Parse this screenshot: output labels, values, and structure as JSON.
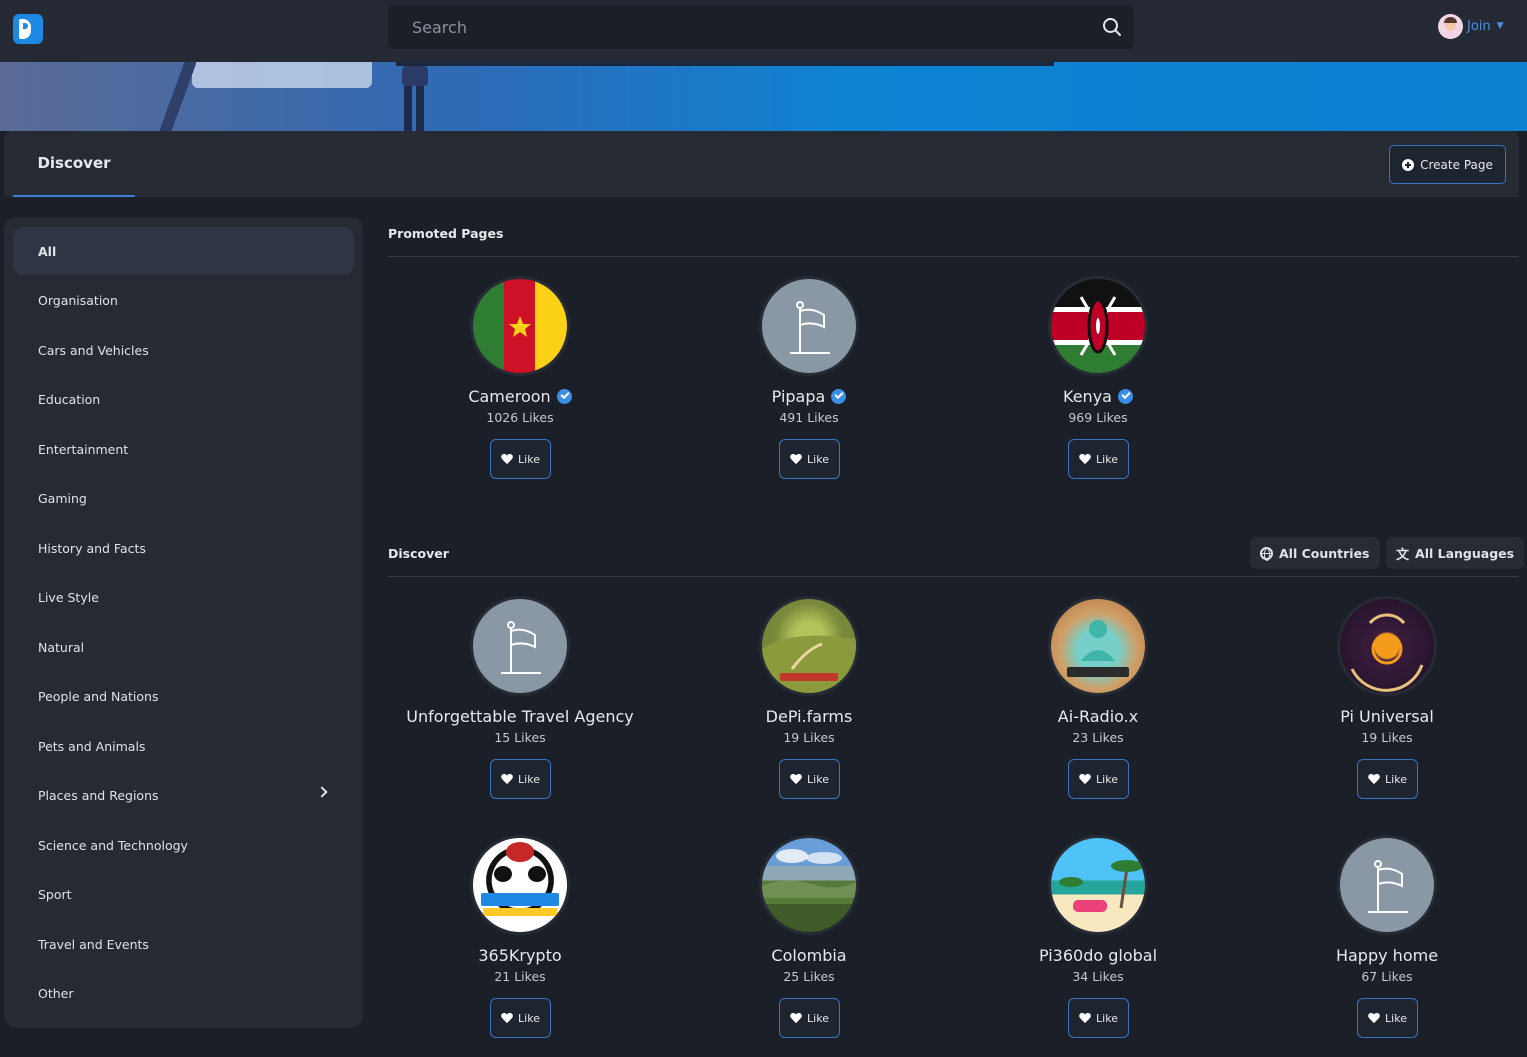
{
  "header": {
    "search_placeholder": "Search",
    "user_label": "Join"
  },
  "discover_header": {
    "tab_label": "Discover",
    "create_button_label": "Create Page"
  },
  "categories": [
    {
      "label": "All",
      "active": true
    },
    {
      "label": "Organisation"
    },
    {
      "label": "Cars and Vehicles"
    },
    {
      "label": "Education"
    },
    {
      "label": "Entertainment"
    },
    {
      "label": "Gaming"
    },
    {
      "label": "History and Facts"
    },
    {
      "label": "Live Style"
    },
    {
      "label": "Natural"
    },
    {
      "label": "People and Nations"
    },
    {
      "label": "Pets and Animals"
    },
    {
      "label": "Places and Regions",
      "has_submenu": true
    },
    {
      "label": "Science and Technology"
    },
    {
      "label": "Sport"
    },
    {
      "label": "Travel and Events"
    },
    {
      "label": "Other"
    }
  ],
  "promoted": {
    "title": "Promoted Pages",
    "pages": [
      {
        "name": "Cameroon",
        "likes": "1026 Likes",
        "verified": true,
        "image": "cameroon-flag",
        "like_label": "Like"
      },
      {
        "name": "Pipapa",
        "likes": "491 Likes",
        "verified": true,
        "image": "default-flag-icon",
        "like_label": "Like"
      },
      {
        "name": "Kenya",
        "likes": "969 Likes",
        "verified": true,
        "image": "kenya-flag",
        "like_label": "Like"
      }
    ]
  },
  "discover": {
    "title": "Discover",
    "filters": {
      "countries_label": "All Countries",
      "languages_label": "All Languages"
    },
    "pages": [
      {
        "name": "Unforgettable Travel Agency",
        "likes": "15 Likes",
        "image": "default-flag-icon",
        "like_label": "Like"
      },
      {
        "name": "DePi.farms",
        "likes": "19 Likes",
        "image": "depi-farms-logo",
        "like_label": "Like"
      },
      {
        "name": "Ai-Radio.x",
        "likes": "23 Likes",
        "image": "ai-radio-logo",
        "like_label": "Like"
      },
      {
        "name": "Pi Universal",
        "likes": "19 Likes",
        "image": "pi-universal-logo",
        "like_label": "Like"
      },
      {
        "name": "365Krypto",
        "likes": "21 Likes",
        "image": "365krypto-logo",
        "like_label": "Like"
      },
      {
        "name": "Colombia",
        "likes": "25 Likes",
        "image": "colombia-landscape",
        "like_label": "Like"
      },
      {
        "name": "Pi360do global",
        "likes": "34 Likes",
        "image": "pi360do-beach",
        "like_label": "Like"
      },
      {
        "name": "Happy home",
        "likes": "67 Likes",
        "image": "default-flag-icon",
        "like_label": "Like"
      }
    ]
  },
  "colors": {
    "background": "#1b1f27",
    "panel": "#252a33",
    "accent": "#3b73c4",
    "verified": "#3a8ee6"
  }
}
